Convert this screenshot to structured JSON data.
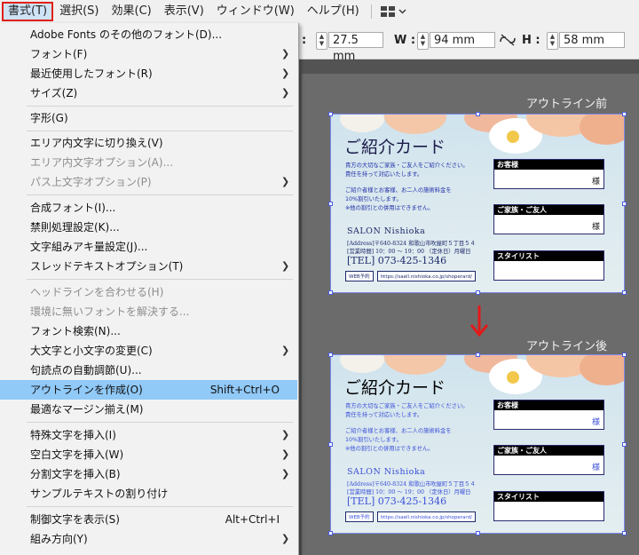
{
  "menubar": {
    "items": [
      "書式(T)",
      "選択(S)",
      "効果(C)",
      "表示(V)",
      "ウィンドウ(W)",
      "ヘルプ(H)"
    ],
    "active_index": 0
  },
  "controlbar": {
    "y_value": "27.5 mm",
    "w_label": "W :",
    "w_value": "94 mm",
    "h_label": "H :",
    "h_value": "58 mm"
  },
  "menu": {
    "items": [
      {
        "label": "Adobe Fonts のその他のフォント(D)...",
        "shortcut": "",
        "submenu": false,
        "disabled": false
      },
      {
        "label": "フォント(F)",
        "shortcut": "",
        "submenu": true,
        "disabled": false
      },
      {
        "label": "最近使用したフォント(R)",
        "shortcut": "",
        "submenu": true,
        "disabled": false
      },
      {
        "label": "サイズ(Z)",
        "shortcut": "",
        "submenu": true,
        "disabled": false
      },
      {
        "label": "字形(G)",
        "shortcut": "",
        "submenu": false,
        "disabled": false
      },
      {
        "label": "エリア内文字に切り換え(V)",
        "shortcut": "",
        "submenu": false,
        "disabled": false
      },
      {
        "label": "エリア内文字オプション(A)...",
        "shortcut": "",
        "submenu": false,
        "disabled": true
      },
      {
        "label": "パス上文字オプション(P)",
        "shortcut": "",
        "submenu": true,
        "disabled": true
      },
      {
        "label": "合成フォント(I)...",
        "shortcut": "",
        "submenu": false,
        "disabled": false
      },
      {
        "label": "禁則処理設定(K)...",
        "shortcut": "",
        "submenu": false,
        "disabled": false
      },
      {
        "label": "文字組みアキ量設定(J)...",
        "shortcut": "",
        "submenu": false,
        "disabled": false
      },
      {
        "label": "スレッドテキストオプション(T)",
        "shortcut": "",
        "submenu": true,
        "disabled": false
      },
      {
        "label": "ヘッドラインを合わせる(H)",
        "shortcut": "",
        "submenu": false,
        "disabled": true
      },
      {
        "label": "環境に無いフォントを解決する...",
        "shortcut": "",
        "submenu": false,
        "disabled": true
      },
      {
        "label": "フォント検索(N)...",
        "shortcut": "",
        "submenu": false,
        "disabled": false
      },
      {
        "label": "大文字と小文字の変更(C)",
        "shortcut": "",
        "submenu": true,
        "disabled": false
      },
      {
        "label": "句読点の自動調節(U)...",
        "shortcut": "",
        "submenu": false,
        "disabled": false
      },
      {
        "label": "アウトラインを作成(O)",
        "shortcut": "Shift+Ctrl+O",
        "submenu": false,
        "disabled": false
      },
      {
        "label": "最適なマージン揃え(M)",
        "shortcut": "",
        "submenu": false,
        "disabled": false
      },
      {
        "label": "特殊文字を挿入(I)",
        "shortcut": "",
        "submenu": true,
        "disabled": false
      },
      {
        "label": "空白文字を挿入(W)",
        "shortcut": "",
        "submenu": true,
        "disabled": false
      },
      {
        "label": "分割文字を挿入(B)",
        "shortcut": "",
        "submenu": true,
        "disabled": false
      },
      {
        "label": "サンプルテキストの割り付け",
        "shortcut": "",
        "submenu": false,
        "disabled": false
      },
      {
        "label": "制御文字を表示(S)",
        "shortcut": "Alt+Ctrl+I",
        "submenu": false,
        "disabled": false
      },
      {
        "label": "組み方向(Y)",
        "shortcut": "",
        "submenu": true,
        "disabled": false
      }
    ],
    "highlighted_index": 17
  },
  "captions": {
    "before": "アウトライン前",
    "after": "アウトライン後"
  },
  "card": {
    "title": "ご紹介カード",
    "body_lines": [
      "貴方の大切なご家族・ご友人をご紹介ください。",
      "責任を持って対応いたします。",
      "ご紹介者様とお客様、お二人の施術料金を",
      "10%割引いたします。",
      "※他の割引との併用はできません。"
    ],
    "salon": "SALON Nishioka",
    "address_lines": [
      "[Address]〒640-8324 和歌山市吹屋町５丁目５４",
      "[営業時間] 10：00 ～ 19：00 （定休日）月曜日"
    ],
    "tel": "[TEL] 073-425-1346",
    "web_label": "WEB予約",
    "web_url": "https://saell.nishioka.co.jp/shoperard/",
    "boxes": [
      {
        "header": "お客様",
        "suffix": "様"
      },
      {
        "header": "ご家族・ご友人",
        "suffix": "様"
      },
      {
        "header": "スタイリスト",
        "suffix": ""
      }
    ]
  }
}
